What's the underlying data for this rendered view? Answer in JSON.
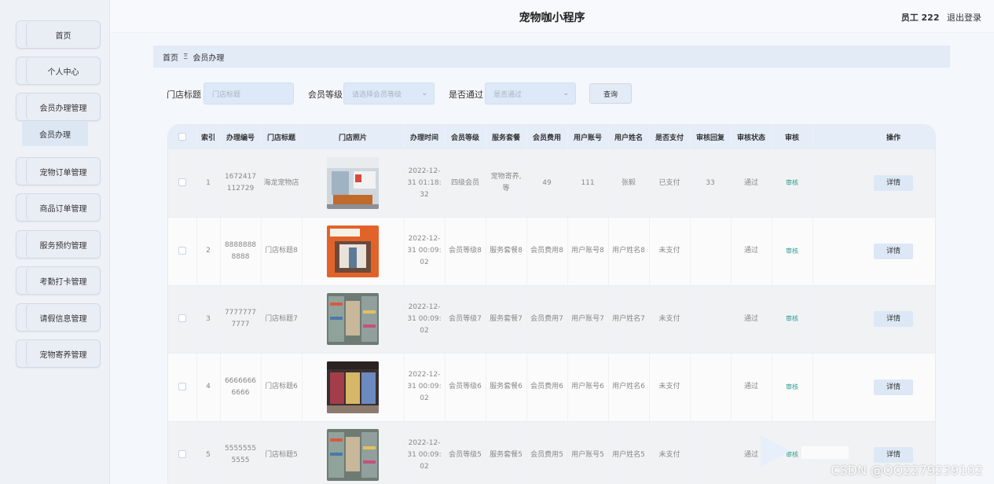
{
  "app": {
    "title": "宠物咖小程序"
  },
  "header": {
    "user_label": "员工 222",
    "logout_label": "退出登录"
  },
  "sidebar": {
    "items": [
      {
        "label": "首页"
      },
      {
        "label": "个人中心"
      },
      {
        "label": "会员办理管理"
      },
      {
        "label": "宠物订单管理"
      },
      {
        "label": "商品订单管理"
      },
      {
        "label": "服务预约管理"
      },
      {
        "label": "考勤打卡管理"
      },
      {
        "label": "请假信息管理"
      },
      {
        "label": "宠物寄养管理"
      }
    ],
    "sub_item": {
      "label": "会员办理"
    }
  },
  "breadcrumb": {
    "home": "首页",
    "separator": "Ξ",
    "current": "会员办理"
  },
  "search": {
    "store_title_label": "门店标题",
    "store_title_placeholder": "门店标题",
    "level_label": "会员等级",
    "level_placeholder": "请选择会员等级",
    "approved_label": "是否通过",
    "approved_placeholder": "是否通过",
    "query_button": "查询"
  },
  "table": {
    "columns": [
      "索引",
      "办理编号",
      "门店标题",
      "门店照片",
      "办理时间",
      "会员等级",
      "服务套餐",
      "会员费用",
      "用户账号",
      "用户姓名",
      "是否支付",
      "审核回复",
      "审核状态",
      "审核",
      "操作"
    ],
    "audit_label": "审核",
    "detail_label": "详情",
    "rows": [
      {
        "index": "1",
        "code": "1672417112729",
        "store": "海龙宠物店",
        "time": "2022-12-31 01:18:32",
        "level": "四级会员",
        "package": "宠物寄养,等",
        "fee": "49",
        "account": "111",
        "name": "张毅",
        "paid": "已支付",
        "reply": "33",
        "status": "通过",
        "photo": "lobby"
      },
      {
        "index": "2",
        "code": "88888888888",
        "store": "门店标题8",
        "time": "2022-12-31 00:09:02",
        "level": "会员等级8",
        "package": "服务套餐8",
        "fee": "会员费用8",
        "account": "用户账号8",
        "name": "用户姓名8",
        "paid": "未支付",
        "reply": "",
        "status": "通过",
        "photo": "storefront"
      },
      {
        "index": "3",
        "code": "77777777777",
        "store": "门店标题7",
        "time": "2022-12-31 00:09:02",
        "level": "会员等级7",
        "package": "服务套餐7",
        "fee": "会员费用7",
        "account": "用户账号7",
        "name": "用户姓名7",
        "paid": "未支付",
        "reply": "",
        "status": "通过",
        "photo": "shelves"
      },
      {
        "index": "4",
        "code": "66666666666",
        "store": "门店标题6",
        "time": "2022-12-31 00:09:02",
        "level": "会员等级6",
        "package": "服务套餐6",
        "fee": "会员费用6",
        "account": "用户账号6",
        "name": "用户姓名6",
        "paid": "未支付",
        "reply": "",
        "status": "通过",
        "photo": "shop"
      },
      {
        "index": "5",
        "code": "55555555555",
        "store": "门店标题5",
        "time": "2022-12-31 00:09:02",
        "level": "会员等级5",
        "package": "服务套餐5",
        "fee": "会员费用5",
        "account": "用户账号5",
        "name": "用户姓名5",
        "paid": "未支付",
        "reply": "",
        "status": "通过",
        "photo": "shelves"
      }
    ]
  },
  "watermark": {
    "text": "CSDN @QQ2279239102"
  }
}
